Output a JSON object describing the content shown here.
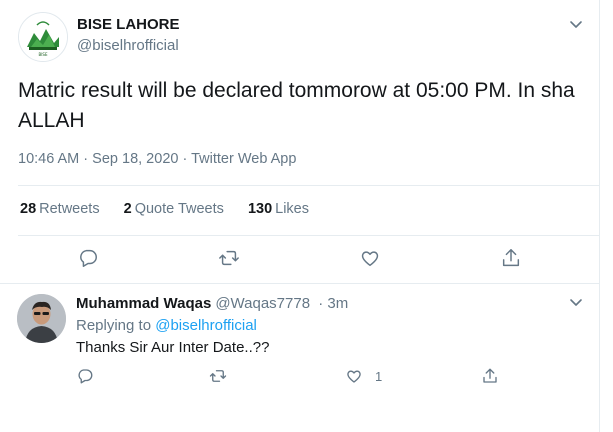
{
  "tweet": {
    "display_name": "BISE LAHORE",
    "handle": "@biselhrofficial",
    "text": "Matric result will be declared tommorow at 05:00 PM. In sha ALLAH",
    "time": "10:46 AM",
    "date": "Sep 18, 2020",
    "source": "Twitter Web App",
    "sep": "·",
    "stats": {
      "retweets_count": "28",
      "retweets_label": "Retweets",
      "quotes_count": "2",
      "quotes_label": "Quote Tweets",
      "likes_count": "130",
      "likes_label": "Likes"
    }
  },
  "reply": {
    "display_name": "Muhammad Waqas",
    "handle": "@Waqas7778",
    "sep": "·",
    "age": "3m",
    "replying_prefix": "Replying to",
    "replying_to": "@biselhrofficial",
    "text": "Thanks Sir Aur Inter Date..??",
    "like_count": "1"
  },
  "icons": {
    "reply": "reply-icon",
    "retweet": "retweet-icon",
    "like": "heart-icon",
    "share": "share-icon",
    "menu": "chevron-down-icon"
  },
  "colors": {
    "link": "#1da1f2",
    "secondary_text": "#657786",
    "primary_text": "#14171a",
    "divider": "#e6ecf0"
  }
}
